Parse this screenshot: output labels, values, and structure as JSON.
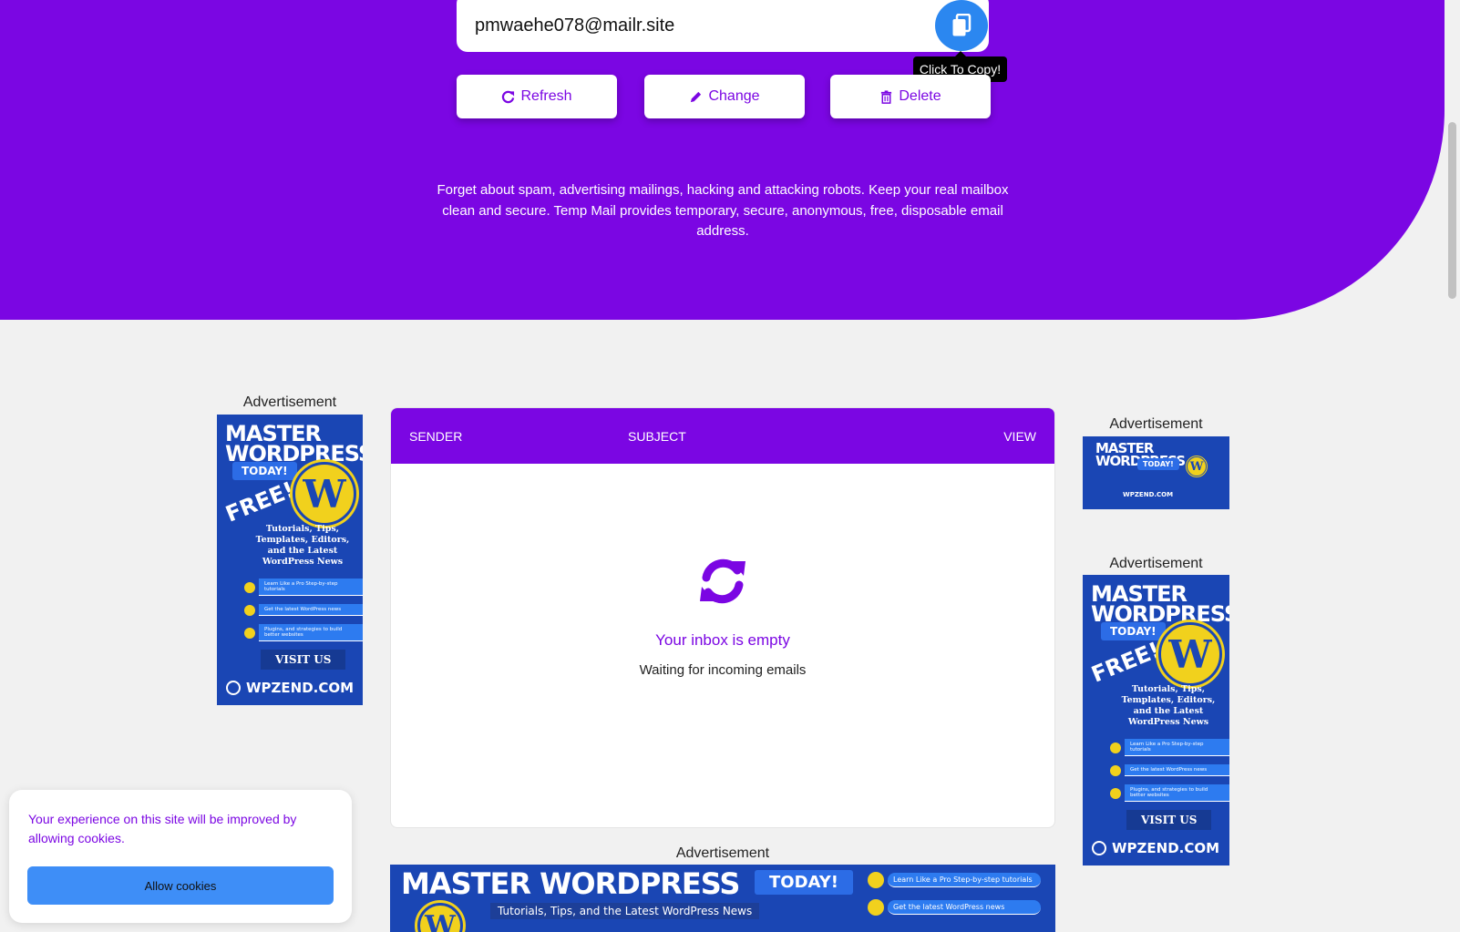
{
  "hero": {
    "email": "pmwaehe078@mailr.site",
    "copy_tooltip": "Click To Copy!",
    "buttons": {
      "refresh": "Refresh",
      "change": "Change",
      "delete": "Delete"
    },
    "description": "Forget about spam, advertising mailings, hacking and attacking robots. Keep your real mailbox clean and secure. Temp Mail provides temporary, secure, anonymous, free, disposable email address."
  },
  "inbox": {
    "columns": {
      "sender": "SENDER",
      "subject": "SUBJECT",
      "view": "VIEW"
    },
    "empty_title": "Your inbox is empty",
    "empty_subtitle": "Waiting for incoming emails"
  },
  "ads": {
    "label": "Advertisement",
    "headline": "MASTER WORDPRESS",
    "today": "TODAY!",
    "free": "FREE!",
    "tips": "Tutorials, Tips, Templates, Editors, and the Latest WordPress News",
    "banner_tips": "Tutorials, Tips, and the Latest WordPress News",
    "bullets": [
      "Learn Like a Pro Step-by-step tutorials",
      "Get the latest WordPress news",
      "Plugins, and strategies to build better websites"
    ],
    "visit": "VISIT US",
    "site": "WPZEND.COM"
  },
  "cookie": {
    "message": "Your experience on this site will be improved by allowing cookies.",
    "button": "Allow cookies"
  },
  "colors": {
    "brand": "#7b06e3",
    "accent_blue": "#2b87f0",
    "cookie_button": "#3e8ef7",
    "ad_blue": "#1a46b4"
  },
  "icons": {
    "copy": "copy-icon",
    "refresh": "refresh-icon",
    "change": "pencil-icon",
    "delete": "trash-icon",
    "empty": "sync-icon"
  }
}
